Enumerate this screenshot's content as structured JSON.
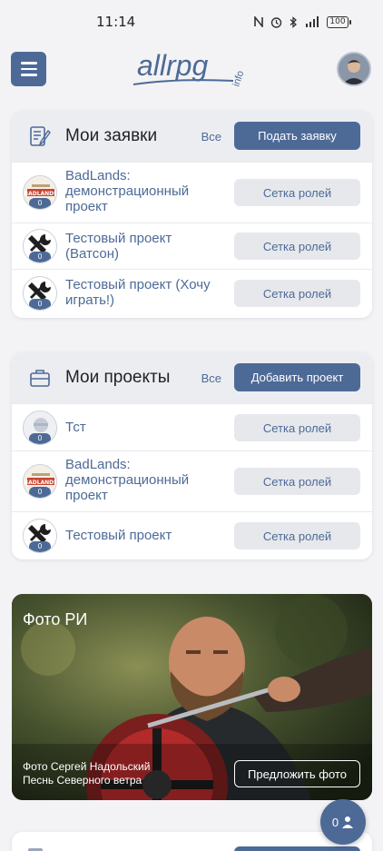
{
  "statusbar": {
    "time": "11:14",
    "icons": [
      "nfc-icon",
      "alarm-icon",
      "bluetooth-icon",
      "signal-icon",
      "battery-icon"
    ],
    "battery": "100"
  },
  "header": {
    "logo_text": "allrpg",
    "logo_suffix": "info"
  },
  "applications": {
    "title": "Мои заявки",
    "all_label": "Все",
    "action_label": "Подать заявку",
    "items": [
      {
        "name": "BadLands: демонстрационный проект",
        "count": "0",
        "button": "Сетка ролей",
        "avatar": "badlands"
      },
      {
        "name": "Тестовый проект (Ватсон)",
        "count": "0",
        "button": "Сетка ролей",
        "avatar": "wrench"
      },
      {
        "name": "Тестовый проект (Хочу играть!)",
        "count": "0",
        "button": "Сетка ролей",
        "avatar": "wrench"
      }
    ]
  },
  "projects": {
    "title": "Мои проекты",
    "all_label": "Все",
    "action_label": "Добавить проект",
    "items": [
      {
        "name": "Тст",
        "count": "0",
        "button": "Сетка ролей",
        "avatar": "placeholder"
      },
      {
        "name": "BadLands: демонстрационный проект",
        "count": "0",
        "button": "Сетка ролей",
        "avatar": "badlands"
      },
      {
        "name": "Тестовый проект",
        "count": "0",
        "button": "Сетка ролей",
        "avatar": "wrench"
      }
    ]
  },
  "photo": {
    "title": "Фото РИ",
    "caption_line1": "Фото Сергей Надольский",
    "caption_line2": "Песнь Северного ветра",
    "button": "Предложить фото"
  },
  "fab": {
    "count": "0"
  },
  "colors": {
    "accent": "#4d6a97",
    "background": "#f3f3f5",
    "card_header": "#ebedf1",
    "secondary_button": "#e6e8ec"
  }
}
